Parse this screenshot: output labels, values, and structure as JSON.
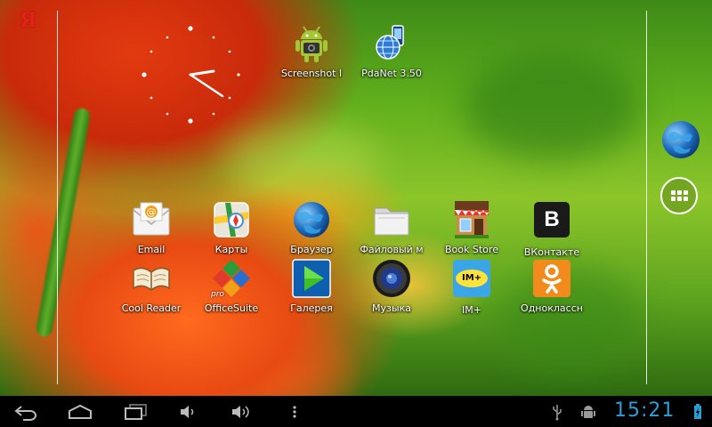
{
  "wallpaper": {
    "description_colors": {
      "green": "#5fae1c",
      "poppy": "#e84a12"
    }
  },
  "brand": {
    "yandex_glyph": "Я",
    "color": "#e8201a"
  },
  "top_apps": [
    {
      "name": "screenshot",
      "label": "Screenshot I",
      "icon": "android-camera-icon"
    },
    {
      "name": "pdanet",
      "label": "PdaNet 3.50",
      "icon": "globe-phone-icon"
    }
  ],
  "apps_row1": [
    {
      "name": "email",
      "label": "Email",
      "icon": "email-icon"
    },
    {
      "name": "maps",
      "label": "Карты",
      "icon": "maps-icon"
    },
    {
      "name": "browser",
      "label": "Браузер",
      "icon": "globe-icon"
    },
    {
      "name": "file-manager",
      "label": "Файловый м",
      "icon": "folder-icon"
    },
    {
      "name": "book-store",
      "label": "Book Store",
      "icon": "store-icon"
    },
    {
      "name": "vkontakte",
      "label": "ВКонтакте",
      "icon": "vk-icon",
      "glyph": "B"
    }
  ],
  "apps_row2": [
    {
      "name": "cool-reader",
      "label": "Cool Reader",
      "icon": "book-icon"
    },
    {
      "name": "officesuite",
      "label": "OfficeSuite",
      "icon": "officesuite-icon",
      "badge": "pro"
    },
    {
      "name": "gallery",
      "label": "Галерея",
      "icon": "play-icon"
    },
    {
      "name": "music",
      "label": "Музыка",
      "icon": "speaker-icon"
    },
    {
      "name": "im-plus",
      "label": "IM+",
      "icon": "im-plus-icon",
      "glyph": "IM+"
    },
    {
      "name": "odnoklassniki",
      "label": "Одноклассн",
      "icon": "ok-icon"
    }
  ],
  "dock": {
    "browser_icon": "globe-icon",
    "all_apps_icon": "grid-icon"
  },
  "status": {
    "time": "15:21",
    "time_color": "#2c9ed6"
  },
  "navbar": {
    "buttons": [
      "back-icon",
      "home-icon",
      "recent-apps-icon",
      "volume-down-icon",
      "volume-up-icon",
      "menu-icon"
    ]
  }
}
